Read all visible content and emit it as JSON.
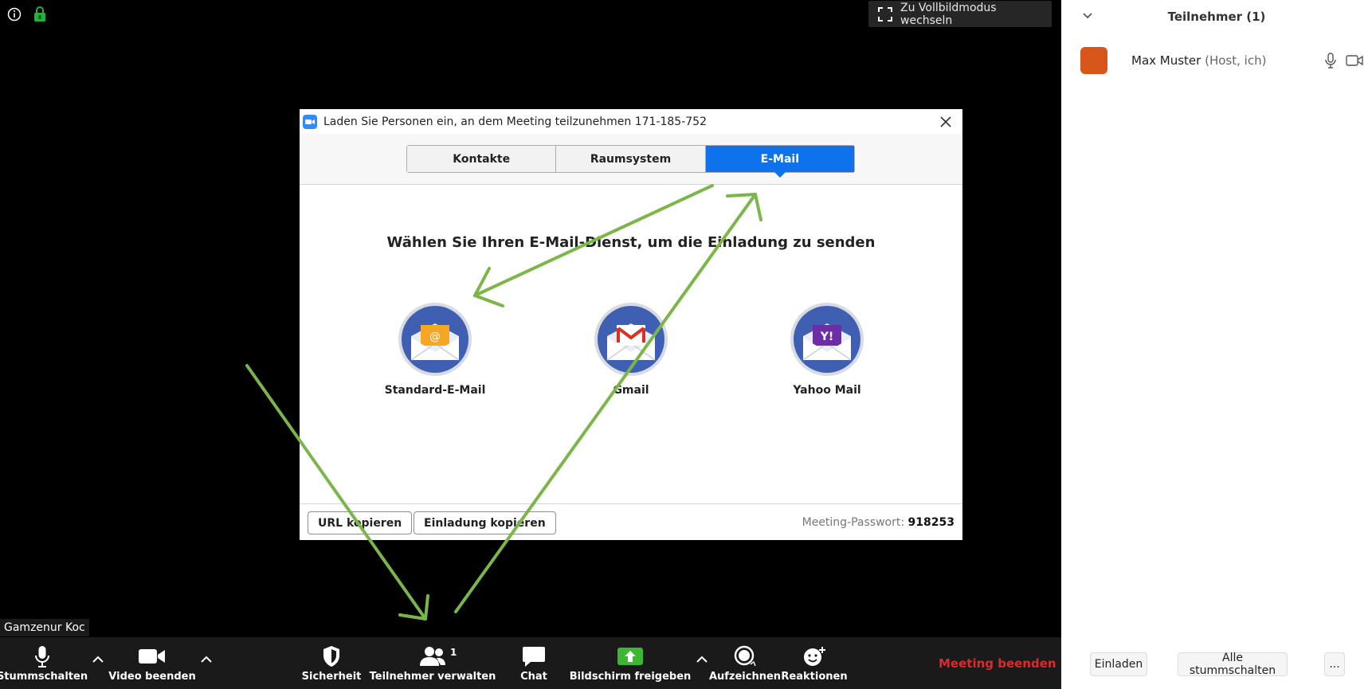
{
  "video": {
    "fullscreen_label": "Zu Vollbildmodus wechseln",
    "participant_name_tag": "Gamzenur Koc"
  },
  "dialog": {
    "title": "Laden Sie Personen ein, an dem Meeting teilzunehmen 171-185-752",
    "tabs": [
      {
        "label": "Kontakte",
        "active": false
      },
      {
        "label": "Raumsystem",
        "active": false
      },
      {
        "label": "E-Mail",
        "active": true
      }
    ],
    "heading": "Wählen Sie Ihren E-Mail-Dienst, um die Einladung zu senden",
    "services": [
      {
        "label": "Standard-E-Mail",
        "icon": "default-mail-icon"
      },
      {
        "label": "Gmail",
        "icon": "gmail-icon"
      },
      {
        "label": "Yahoo Mail",
        "icon": "yahoo-mail-icon"
      }
    ],
    "footer": {
      "copy_url_label": "URL kopieren",
      "copy_invite_label": "Einladung kopieren",
      "password_label": "Meeting-Passwort:",
      "password_value": "918253"
    }
  },
  "toolbar": {
    "mute_label": "Stummschalten",
    "video_label": "Video beenden",
    "security_label": "Sicherheit",
    "participants_label": "Teilnehmer verwalten",
    "participants_count": "1",
    "chat_label": "Chat",
    "share_label": "Bildschirm freigeben",
    "record_label": "Aufzeichnen",
    "reactions_label": "Reaktionen",
    "end_label": "Meeting beenden",
    "end_color": "#e02828",
    "share_color": "#3db733"
  },
  "sidebar": {
    "title": "Teilnehmer (1)",
    "participant": {
      "name": "Max Muster",
      "role": "(Host, ich)",
      "avatar_color": "#d9561a"
    },
    "invite_label": "Einladen",
    "mute_all_label": "Alle stummschalten",
    "more_label": "..."
  },
  "colors": {
    "accent": "#0e72ed",
    "annotation": "#7ab648"
  }
}
